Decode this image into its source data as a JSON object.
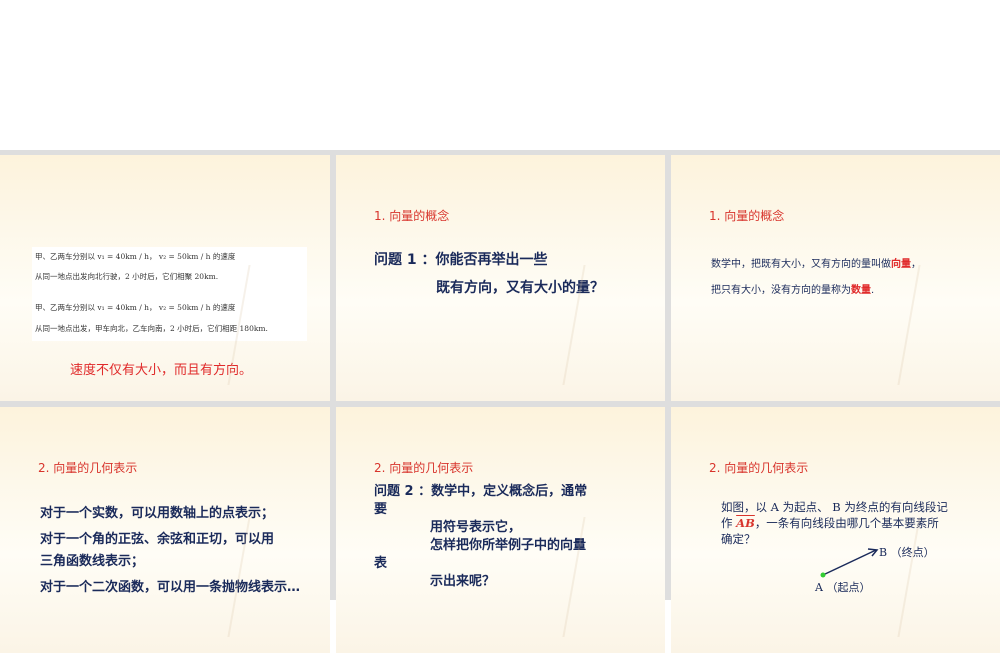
{
  "slides": [
    {
      "lines": [
        "甲、乙两车分别以 v₁ = 40km / h， v₂ = 50km / h 的速度",
        "从同一地点出发向北行驶，2 小时后，它们相聚 20km.",
        "甲、乙两车分别以 v₁ = 40km / h， v₂ = 50km / h 的速度",
        "从同一地点出发，甲车向北，乙车向南，2 小时后，它们相距 180km."
      ],
      "caption": "速度不仅有大小，而且有方向。"
    },
    {
      "title": "1. 向量的概念",
      "q1": "问题 1 ：你能否再举出一些",
      "q2": "既有方向，又有大小的量？"
    },
    {
      "title": "1. 向量的概念",
      "l1a": "数学中，把既有大小，又有方向的量叫做",
      "l1b": "向量",
      "l1c": "，",
      "l2a": "把只有大小，没有方向的量称为",
      "l2b": "数量",
      "l2c": "."
    },
    {
      "title": "2. 向量的几何表示",
      "lines": [
        "对于一个实数，可以用数轴上的点表示；",
        "对于一个角的正弦、余弦和正切，可以用",
        "三角函数线表示；",
        "对于一个二次函数，可以用一条抛物线表示…"
      ]
    },
    {
      "title": "2. 向量的几何表示",
      "lines": [
        "问题 2 ：数学中，定义概念后，通常",
        "要",
        "用符号表示它，",
        "怎样把你所举例子中的向量",
        "表",
        "示出来呢？"
      ]
    },
    {
      "title": "2. 向量的几何表示",
      "lines": [
        "如图，以 A 为起点、 B 为终点的有向线段记",
        "作",
        "，一条有向线段由哪几个基本要素所",
        "确定？"
      ],
      "symbol": "AB",
      "b_label": "B （终点）",
      "a_label": "A （起点）"
    }
  ]
}
